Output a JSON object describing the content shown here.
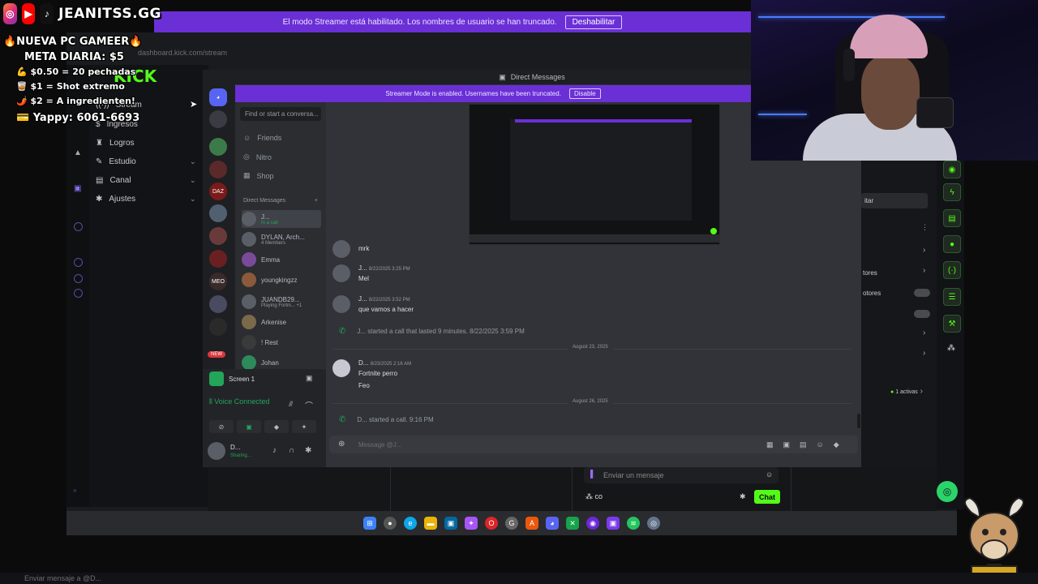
{
  "overlay": {
    "handle": "JEANITSS.GG",
    "lines": [
      "🔥NUEVA PC GAMEER🔥",
      "META DIARIA: $5",
      "💪 $0.50 = 20 pechadas",
      "🥃 $1 = Shot extremo",
      "🌶️ $2 = A ingredienten!",
      "💳 Yappy: 6061-6693"
    ]
  },
  "top_banner": {
    "text": "El modo Streamer está habilitado. Los nombres de usuario se han truncado.",
    "button": "Deshabilitar"
  },
  "browser": {
    "url": "dashboard.kick.com/stream",
    "logo": "KICK"
  },
  "kick_sidebar": {
    "items": [
      "Stream",
      "Ingresos",
      "Logros",
      "Estudio",
      "Canal",
      "Ajustes"
    ]
  },
  "kick_right": {
    "partial_button": "itar",
    "partial_labels": [
      "tores",
      "otores"
    ],
    "activas": "1 activas",
    "chat_placeholder": "Enviar un mensaje",
    "chat_user_count": "co",
    "chat_button": "Chat"
  },
  "discord": {
    "window_title": "Direct Messages",
    "banner_text": "Streamer Mode is enabled. Usernames have been truncated.",
    "banner_button": "Disable",
    "search_placeholder": "Find or start a conversa...",
    "nav": [
      "Friends",
      "Nitro",
      "Shop"
    ],
    "dm_header": "Direct Messages",
    "dms": [
      {
        "name": "J...",
        "sub": "In a call"
      },
      {
        "name": "DYLAN, Arch...",
        "sub": "4 Members"
      },
      {
        "name": "Emma",
        "sub": ""
      },
      {
        "name": "youngkingzz",
        "sub": ""
      },
      {
        "name": "JUANDB29...",
        "sub": "Playing Fortni... +1"
      },
      {
        "name": "Arkenise",
        "sub": ""
      },
      {
        "name": "! Rest",
        "sub": ""
      },
      {
        "name": "Johan",
        "sub": ""
      }
    ],
    "new_badge": "NEW",
    "screen_label": "Screen 1",
    "voice_connected": "Voice Connected",
    "user_name": "D...",
    "user_status": "Sharing...",
    "messages": [
      {
        "author": "",
        "time": "",
        "text": "mrk"
      },
      {
        "author": "J...",
        "time": "8/22/2025 3:25 PM",
        "text": "Mel"
      },
      {
        "author": "J...",
        "time": "8/22/2025 3:52 PM",
        "text": "que vamos a hacer"
      }
    ],
    "call1": "J... started a call that lasted 9 minutes. 8/22/2025 3:59 PM",
    "date1": "August 23, 2025",
    "msg_d": {
      "author": "D...",
      "time": "8/23/2025 2:16 AM",
      "lines": [
        "Fortnite perro",
        "Feo"
      ]
    },
    "date2": "August 26, 2025",
    "call2": "D... started a call. 9:16 PM",
    "input_placeholder": "Message @J..."
  },
  "bottom_chat": {
    "placeholder": "Enviar mensaje a @D..."
  },
  "colors": {
    "streamer_purple": "#6b2fd6",
    "kick_green": "#53fc18",
    "discord_bg": "#313338"
  }
}
